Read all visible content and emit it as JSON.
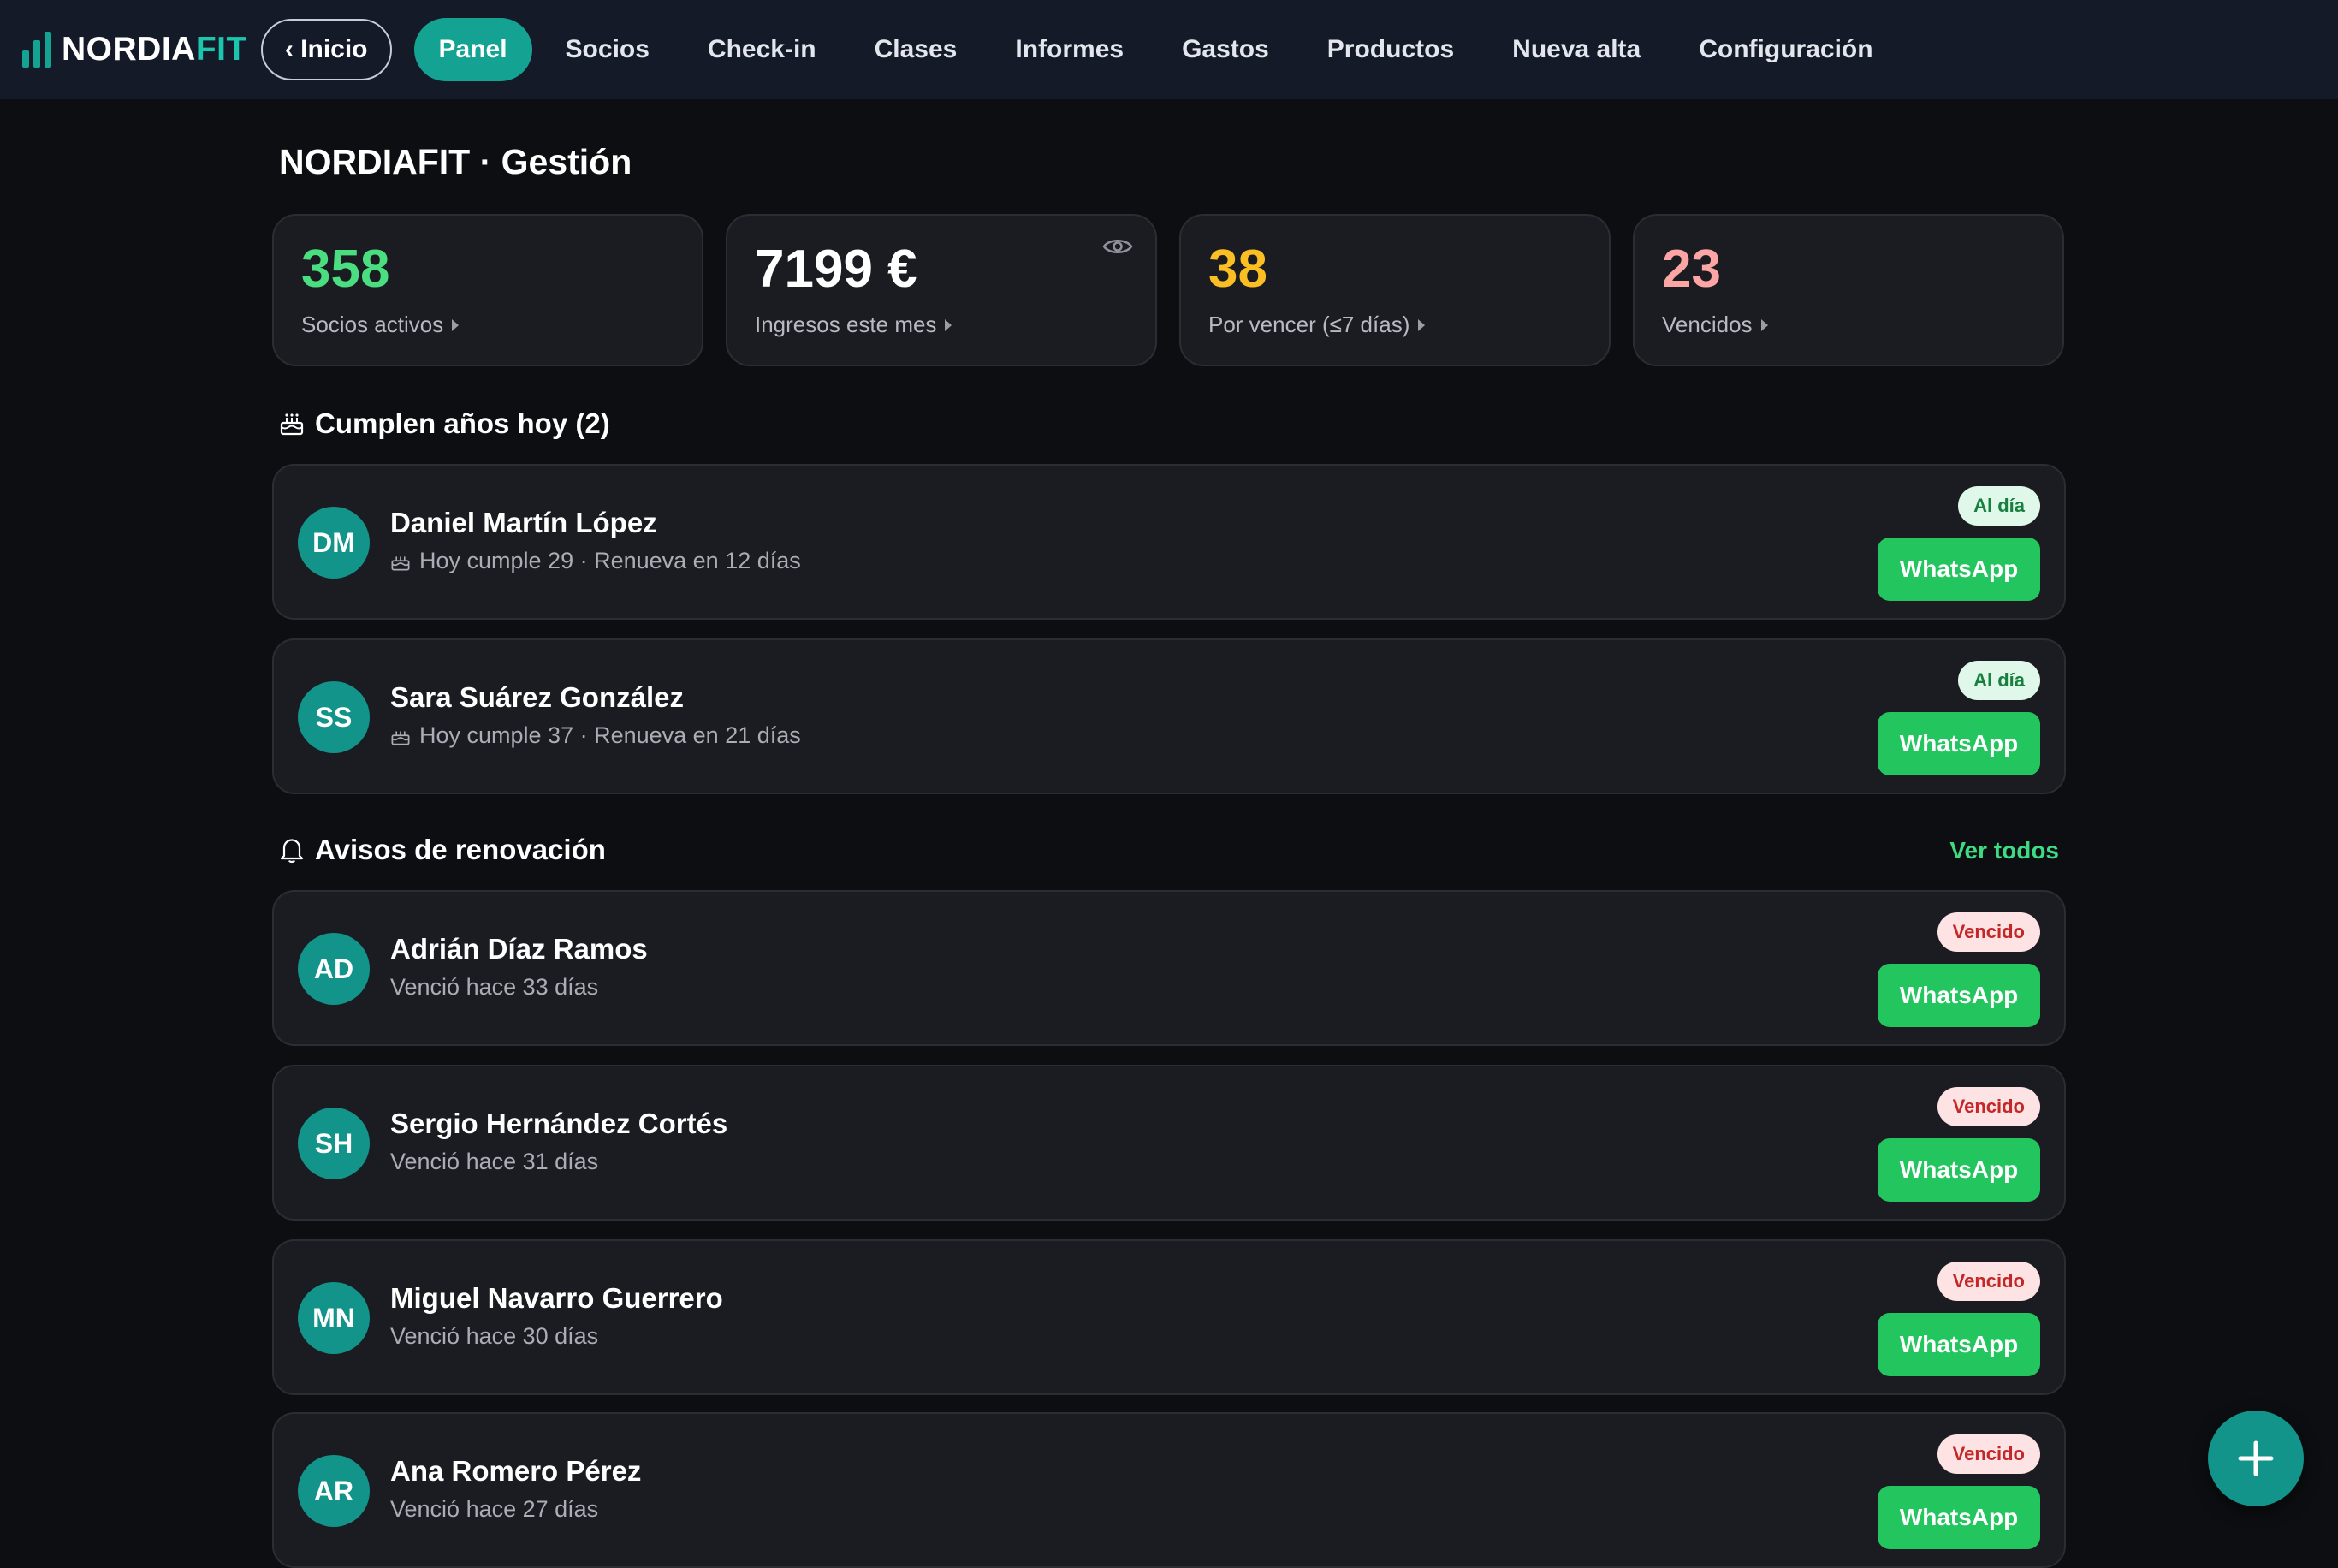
{
  "brand": {
    "part1": "NORDIA",
    "part2": "FIT",
    "accent": "#1cc5ae"
  },
  "nav": {
    "back_label": "‹ Inicio",
    "items": [
      {
        "label": "Panel",
        "active": true
      },
      {
        "label": "Socios"
      },
      {
        "label": "Check-in"
      },
      {
        "label": "Clases"
      },
      {
        "label": "Informes"
      },
      {
        "label": "Gastos"
      },
      {
        "label": "Productos"
      },
      {
        "label": "Nueva alta"
      },
      {
        "label": "Configuración"
      }
    ]
  },
  "page": {
    "title": "NORDIAFIT · Gestión"
  },
  "stats": [
    {
      "value": "358",
      "label": "Socios activos",
      "color": "#4ade80"
    },
    {
      "value": "7199 €",
      "label": "Ingresos este mes",
      "color": "#ffffff",
      "icon": "eye-icon"
    },
    {
      "value": "38",
      "label": "Por vencer (≤7 días)",
      "color": "#fbbf24"
    },
    {
      "value": "23",
      "label": "Vencidos",
      "color": "#fca5a5"
    }
  ],
  "birthdays": {
    "title": "Cumplen años hoy (2)",
    "icon": "cake-icon",
    "items": [
      {
        "initials": "DM",
        "name": "Daniel Martín López",
        "detail": "Hoy cumple 29 · Renueva en 12 días",
        "status": "Al día",
        "action": "WhatsApp"
      },
      {
        "initials": "SS",
        "name": "Sara Suárez González",
        "detail": "Hoy cumple 37 · Renueva en 21 días",
        "status": "Al día",
        "action": "WhatsApp"
      }
    ]
  },
  "renewals": {
    "title": "Avisos de renovación",
    "icon": "bell-icon",
    "see_all": "Ver todos",
    "items": [
      {
        "initials": "AD",
        "name": "Adrián Díaz Ramos",
        "detail": "Venció hace 33 días",
        "status": "Vencido",
        "action": "WhatsApp"
      },
      {
        "initials": "SH",
        "name": "Sergio Hernández Cortés",
        "detail": "Venció hace 31 días",
        "status": "Vencido",
        "action": "WhatsApp"
      },
      {
        "initials": "MN",
        "name": "Miguel Navarro Guerrero",
        "detail": "Venció hace 30 días",
        "status": "Vencido",
        "action": "WhatsApp"
      },
      {
        "initials": "AR",
        "name": "Ana Romero Pérez",
        "detail": "Venció hace 27 días",
        "status": "Vencido",
        "action": "WhatsApp"
      }
    ]
  },
  "fab": {
    "icon": "plus-icon"
  }
}
